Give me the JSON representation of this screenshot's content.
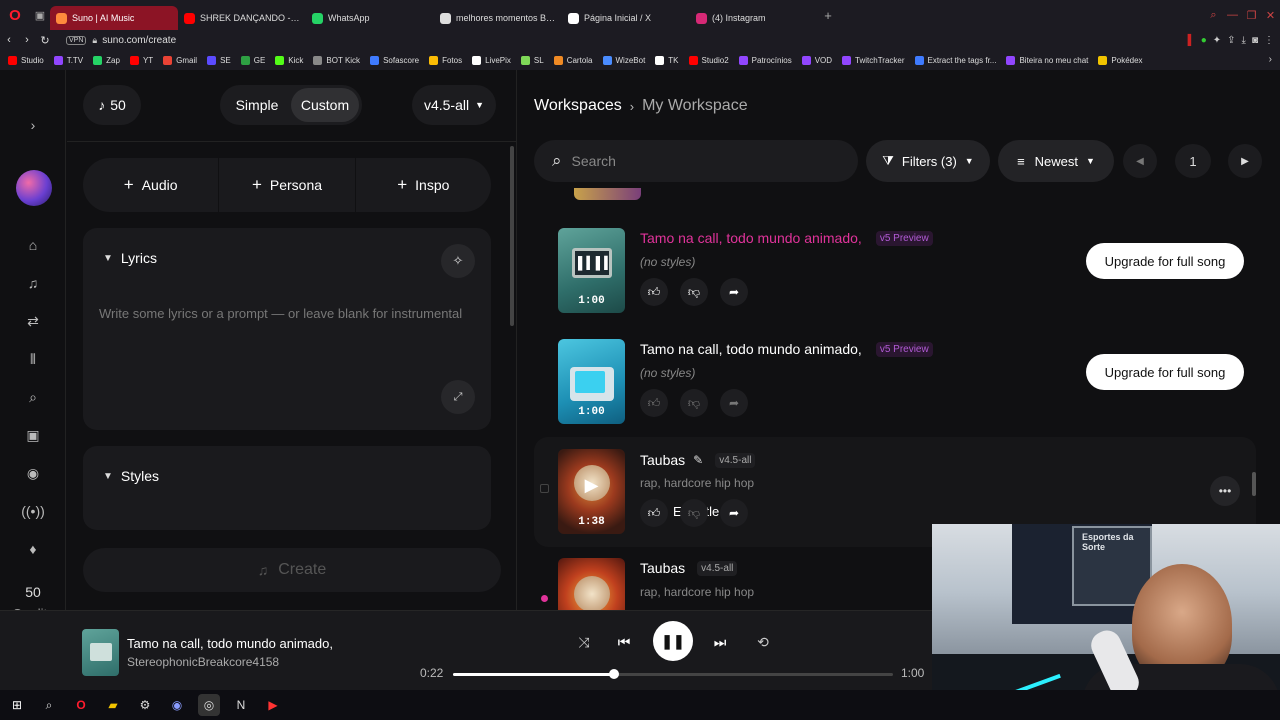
{
  "browser": {
    "tabs": [
      {
        "label": "Suno | AI Music",
        "color": "#ff8a3d",
        "active": true
      },
      {
        "label": "SHREK DANÇANDO - You",
        "color": "#ff0000",
        "active": false
      },
      {
        "label": "WhatsApp",
        "color": "#25d366",
        "active": false
      },
      {
        "label": "melhores momentos BOL",
        "color": "#dddddd",
        "active": false
      },
      {
        "label": "Página Inicial / X",
        "color": "#ffffff",
        "active": false
      },
      {
        "label": "(4) Instagram",
        "color": "#d62976",
        "active": false
      }
    ],
    "url": "suno.com/create",
    "vpn_label": "VPN",
    "bookmarks": [
      {
        "label": "Studio",
        "color": "#ff0000"
      },
      {
        "label": "T.TV",
        "color": "#9146ff"
      },
      {
        "label": "Zap",
        "color": "#25d366"
      },
      {
        "label": "YT",
        "color": "#ff0000"
      },
      {
        "label": "Gmail",
        "color": "#ea4335"
      },
      {
        "label": "SE",
        "color": "#5b4bff"
      },
      {
        "label": "GE",
        "color": "#2ea043"
      },
      {
        "label": "Kick",
        "color": "#53fc18"
      },
      {
        "label": "BOT Kick",
        "color": "#888888"
      },
      {
        "label": "Sofascore",
        "color": "#3f7bff"
      },
      {
        "label": "Fotos",
        "color": "#fbbc05"
      },
      {
        "label": "LivePix",
        "color": "#ffffff"
      },
      {
        "label": "SL",
        "color": "#7fd858"
      },
      {
        "label": "Cartola",
        "color": "#f08a24"
      },
      {
        "label": "WizeBot",
        "color": "#4a8cff"
      },
      {
        "label": "TK",
        "color": "#ffffff"
      },
      {
        "label": "Studio2",
        "color": "#ff0000"
      },
      {
        "label": "Patrocínios",
        "color": "#9146ff"
      },
      {
        "label": "VOD",
        "color": "#9146ff"
      },
      {
        "label": "TwitchTracker",
        "color": "#9146ff"
      },
      {
        "label": "Extract the tags fr...",
        "color": "#3f7bff"
      },
      {
        "label": "Biteira no meu chat",
        "color": "#9146ff"
      },
      {
        "label": "Pokédex",
        "color": "#f2c400"
      }
    ]
  },
  "rail": {
    "credits_value": "50",
    "credits_label": "Credits"
  },
  "create": {
    "credits_chip": "50",
    "mode_simple": "Simple",
    "mode_custom": "Custom",
    "model": "v4.5-all",
    "add_audio": "Audio",
    "add_persona": "Persona",
    "add_inspo": "Inspo",
    "lyrics_label": "Lyrics",
    "lyrics_placeholder": "Write some lyrics or a prompt — or leave blank for instrumental",
    "styles_label": "Styles",
    "create_label": "Create"
  },
  "workspace": {
    "crumb_root": "Workspaces",
    "crumb_current": "My Workspace",
    "search_placeholder": "Search",
    "filters_label": "Filters (3)",
    "sort_label": "Newest",
    "page_number": "1",
    "songs": [
      {
        "title": "Tamo na call, todo mundo animado,",
        "badge": "v5 Preview",
        "styles": "(no styles)",
        "duration": "1:00",
        "action": "Upgrade for full song"
      },
      {
        "title": "Tamo na call, todo mundo animado,",
        "badge": "v5 Preview",
        "styles": "(no styles)",
        "duration": "1:00",
        "action": "Upgrade for full song"
      },
      {
        "title": "Taubas",
        "badge": "v4.5-all",
        "styles": "rap, hardcore hip hop",
        "duration": "1:38",
        "tooltip": "Edit title"
      },
      {
        "title": "Taubas",
        "badge": "v4.5-all",
        "styles": "rap, hardcore hip hop"
      }
    ]
  },
  "player": {
    "title": "Tamo na call, todo mundo animado,",
    "artist": "StereophonicBreakcore4158",
    "current_time": "0:22",
    "total_time": "1:00",
    "progress": 0.367
  },
  "webcam": {
    "sign_text": "Esportes da Sorte"
  },
  "colors": {
    "accent_pink": "#e0339a",
    "v5_badge": "#b25bd6",
    "active_tab": "#8c1425"
  }
}
